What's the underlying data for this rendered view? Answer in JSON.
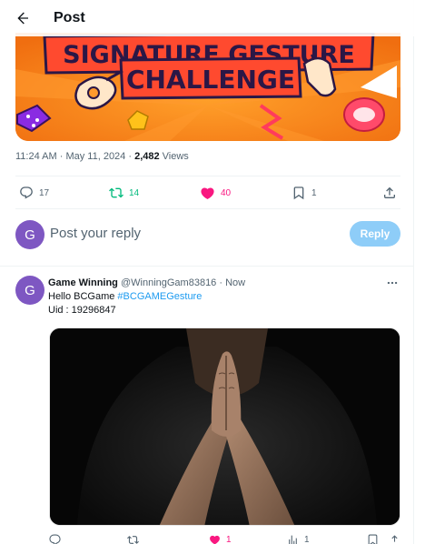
{
  "header": {
    "title": "Post",
    "back_icon": "arrow-left-icon"
  },
  "banner": {
    "line1": "SIGNATURE GESTURE",
    "line2": "CHALLENGE",
    "colors": {
      "background": "#f47f1b",
      "text": "#2b1746",
      "accent": "#ffc21a"
    }
  },
  "post_meta": {
    "time": "11:24 AM",
    "separator": " · ",
    "date": "May 11, 2024",
    "separator2": " · ",
    "views_count": "2,482",
    "views_label": " Views"
  },
  "actions": {
    "replies": "17",
    "reposts": "14",
    "likes": "40",
    "bookmarks": "1"
  },
  "composer": {
    "avatar_letter": "G",
    "placeholder": "Post your reply",
    "reply_label": "Reply"
  },
  "reply": {
    "avatar_letter": "G",
    "author_name": "Game Winning",
    "author_handle": "@WinningGam83816",
    "dot": " · ",
    "time": "Now",
    "line1_text": "Hello BCGame ",
    "hashtag": "#BCGAMEGesture",
    "line2_text": "Uid : 19296847",
    "likes": "1",
    "views": "1"
  },
  "colors": {
    "accent": "#1d9bf0",
    "like": "#f91880",
    "repost": "#00ba7c",
    "avatar": "#7e57c2",
    "reply_button": "#8ecdf8"
  }
}
